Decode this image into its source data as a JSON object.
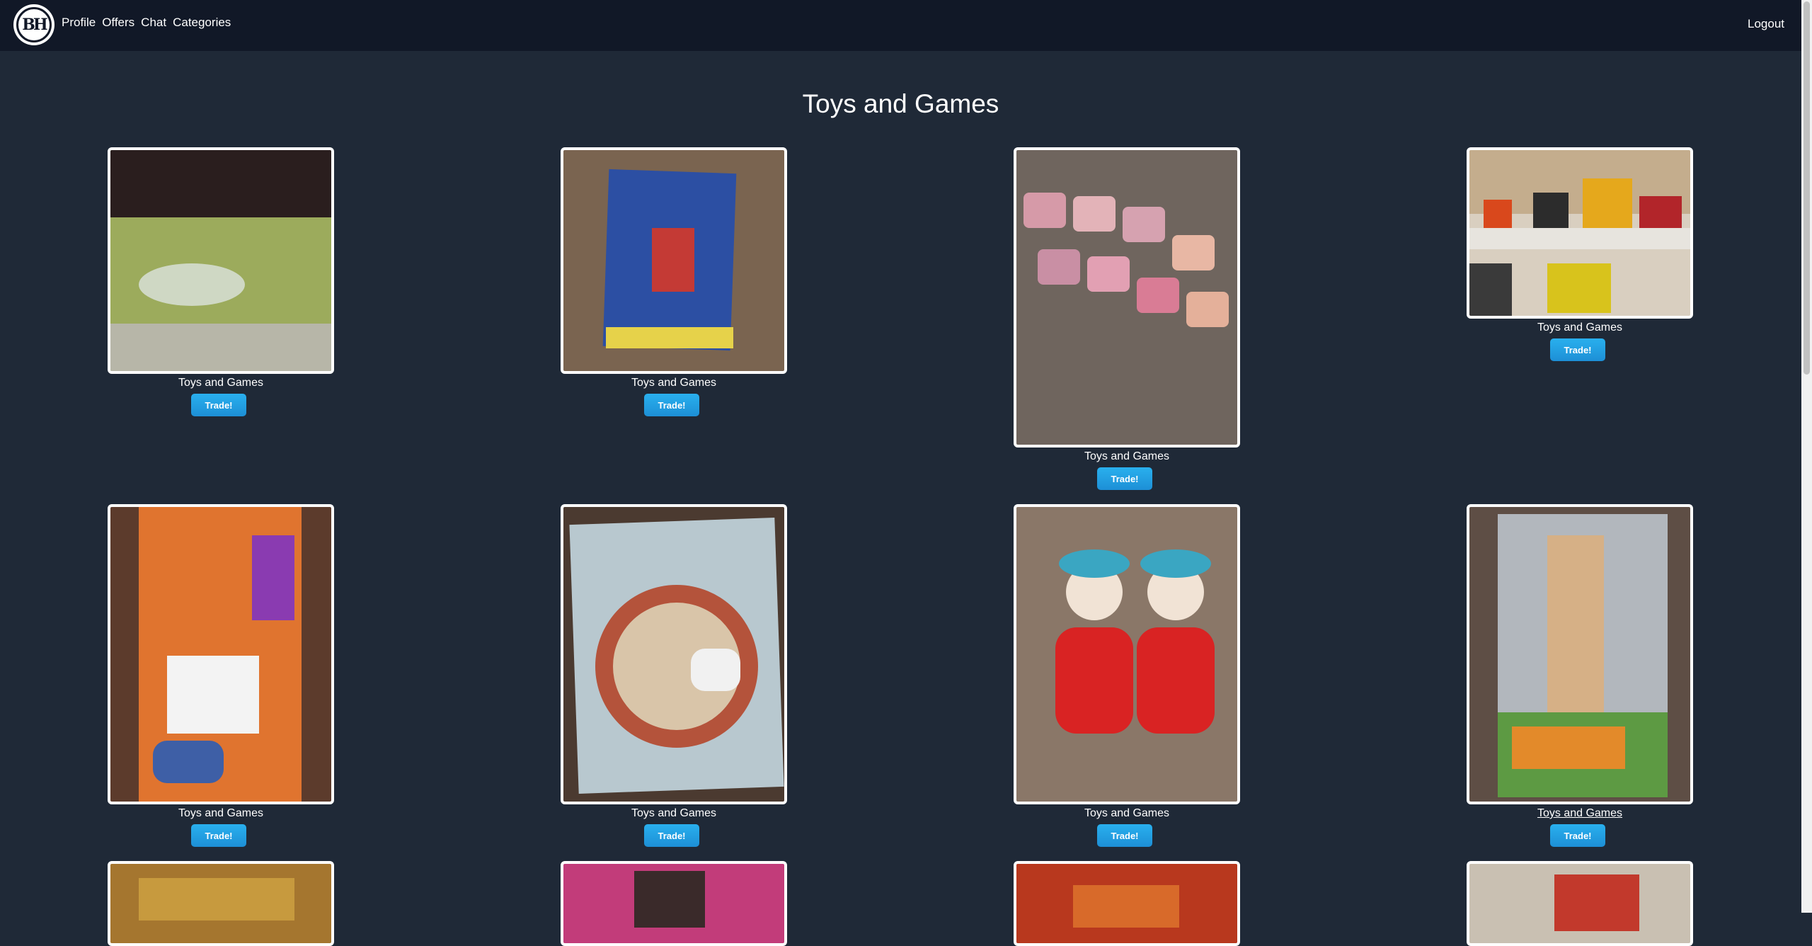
{
  "nav": {
    "logo_text": "BH",
    "links": [
      "Profile",
      "Offers",
      "Chat",
      "Categories"
    ],
    "logout": "Logout"
  },
  "page": {
    "title": "Toys and Games"
  },
  "items": [
    {
      "category": "Toys and Games",
      "button": "Trade!",
      "photo": "storage-box"
    },
    {
      "category": "Toys and Games",
      "button": "Trade!",
      "photo": "santa-craft-kit"
    },
    {
      "category": "Toys and Games",
      "button": "Trade!",
      "photo": "beanie-babies"
    },
    {
      "category": "Toys and Games",
      "button": "Trade!",
      "photo": "toy-trucks"
    },
    {
      "category": "Toys and Games",
      "button": "Trade!",
      "photo": "toy-keyboard"
    },
    {
      "category": "Toys and Games",
      "button": "Trade!",
      "photo": "yeti-game"
    },
    {
      "category": "Toys and Games",
      "button": "Trade!",
      "photo": "thing-plushies"
    },
    {
      "category": "Toys and Games",
      "button": "Trade!",
      "photo": "bratz-doll"
    }
  ],
  "colors": {
    "background": "#1f2937",
    "navbar": "#111827",
    "button": "#1d9be3"
  }
}
